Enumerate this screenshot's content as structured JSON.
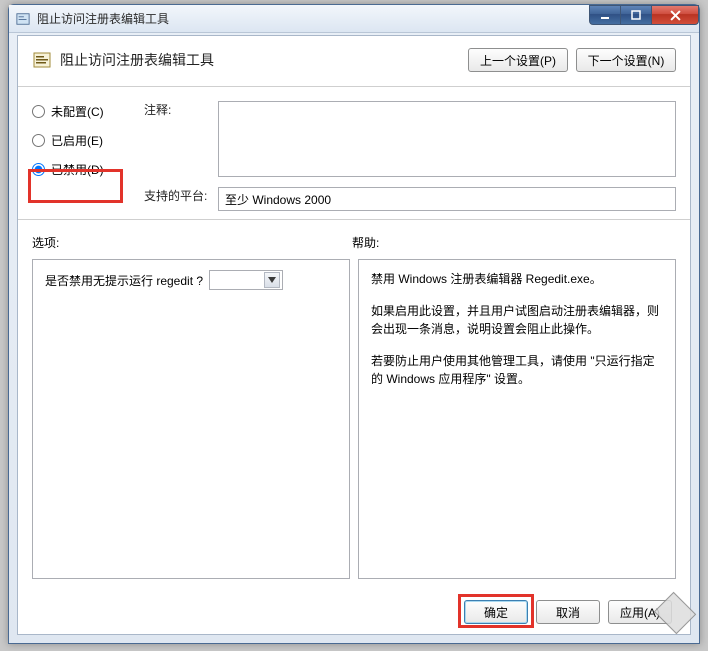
{
  "titlebar": {
    "title": "阻止访问注册表编辑工具"
  },
  "header": {
    "title": "阻止访问注册表编辑工具",
    "prev_button": "上一个设置(P)",
    "next_button": "下一个设置(N)"
  },
  "radios": {
    "not_configured": "未配置(C)",
    "enabled": "已启用(E)",
    "disabled": "已禁用(D)",
    "selected": "disabled"
  },
  "labels": {
    "comment": "注释:",
    "supported": "支持的平台:",
    "options": "选项:",
    "help": "帮助:"
  },
  "supported_platforms": "至少 Windows 2000",
  "options_panel": {
    "question": "是否禁用无提示运行 regedit ?"
  },
  "help_panel": {
    "p1": "禁用 Windows 注册表编辑器 Regedit.exe。",
    "p2": "如果启用此设置，并且用户试图启动注册表编辑器，则会出现一条消息，说明设置会阻止此操作。",
    "p3": "若要防止用户使用其他管理工具，请使用 \"只运行指定的 Windows 应用程序\" 设置。"
  },
  "footer": {
    "ok": "确定",
    "cancel": "取消",
    "apply": "应用(A)"
  }
}
